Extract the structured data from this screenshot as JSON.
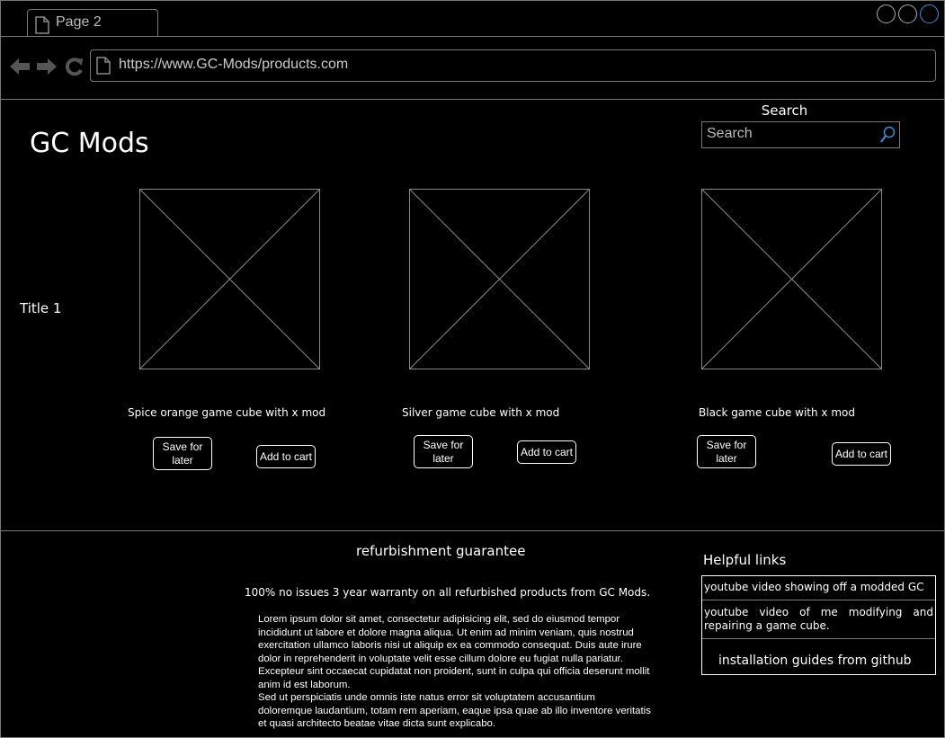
{
  "browser": {
    "tab_label": "Page 2",
    "url": "https://www.GC-Mods/products.com"
  },
  "header": {
    "brand": "GC Mods",
    "search_label": "Search",
    "search_placeholder": "Search"
  },
  "sidebar": {
    "title": "Title 1"
  },
  "products": [
    {
      "name": "Spice orange game cube with x mod",
      "save_label": "Save for later",
      "cart_label": "Add to cart"
    },
    {
      "name": "Silver game cube with x mod",
      "save_label": "Save for later",
      "cart_label": "Add to cart"
    },
    {
      "name": "Black game cube with x mod",
      "save_label": "Save for later",
      "cart_label": "Add to cart"
    }
  ],
  "footer": {
    "guarantee_title": "refurbishment guarantee",
    "warranty": "100% no issues 3 year warranty on all refurbished products from GC Mods.",
    "lorem_1": "Lorem ipsum dolor sit amet, consectetur adipisicing elit, sed do eiusmod tempor incididunt ut labore et dolore magna aliqua. Ut enim ad minim veniam, quis nostrud exercitation ullamco laboris nisi ut aliquip ex ea commodo consequat. Duis aute irure dolor in reprehenderit in voluptate velit esse cillum dolore eu fugiat nulla pariatur. Excepteur sint occaecat cupidatat non proident, sunt in culpa qui officia deserunt mollit anim id est laborum.",
    "lorem_2": "Sed ut perspiciatis unde omnis iste natus error sit voluptatem accusantium doloremque laudantium, totam rem aperiam, eaque ipsa quae ab illo inventore veritatis et quasi architecto beatae vitae dicta sunt explicabo.",
    "links_title": "Helpful links",
    "links": [
      "youtube video showing off a modded GC",
      "youtube video of me modifying and repairing a game cube.",
      "installation guides from github"
    ]
  },
  "colors": {
    "background": "#000000",
    "text": "#ffffff",
    "border": "#777777",
    "accent": "#3a8fd6"
  }
}
